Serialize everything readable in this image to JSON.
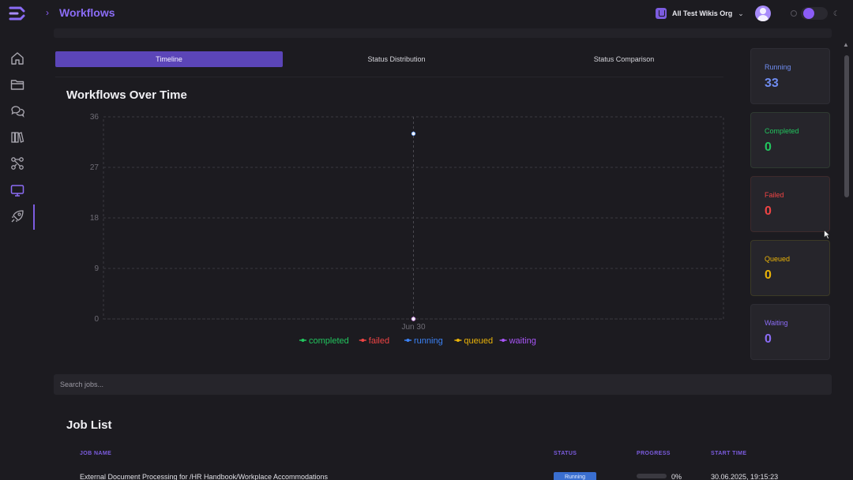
{
  "header": {
    "breadcrumb_title": "Workflows",
    "org_name": "All Test Wikis Org"
  },
  "sidebar": {
    "items": [
      {
        "icon": "home-icon"
      },
      {
        "icon": "folder-icon"
      },
      {
        "icon": "chat-icon"
      },
      {
        "icon": "library-icon"
      },
      {
        "icon": "workflow-icon"
      },
      {
        "icon": "monitor-icon",
        "active": true
      },
      {
        "icon": "rocket-icon"
      }
    ]
  },
  "tabs": [
    {
      "label": "Timeline",
      "active": true
    },
    {
      "label": "Status Distribution",
      "active": false
    },
    {
      "label": "Status Comparison",
      "active": false
    }
  ],
  "chart": {
    "title": "Workflows Over Time"
  },
  "chart_data": {
    "type": "line",
    "title": "Workflows Over Time",
    "x": [
      "Jun 30"
    ],
    "y_ticks": [
      0,
      9,
      18,
      27,
      36
    ],
    "ylim": [
      0,
      36
    ],
    "grid": true,
    "legend_position": "bottom",
    "series": [
      {
        "name": "completed",
        "values": [
          0
        ],
        "color": "#22c55e"
      },
      {
        "name": "failed",
        "values": [
          0
        ],
        "color": "#ef4444"
      },
      {
        "name": "running",
        "values": [
          33
        ],
        "color": "#3b82f6"
      },
      {
        "name": "queued",
        "values": [
          0
        ],
        "color": "#eab308"
      },
      {
        "name": "waiting",
        "values": [
          0
        ],
        "color": "#a855f7"
      }
    ]
  },
  "status_cards": [
    {
      "label": "Running",
      "value": "33",
      "color": "#6f8cf0",
      "border": "#2e2d34"
    },
    {
      "label": "Completed",
      "value": "0",
      "color": "#22c55e",
      "border": "#2f3a31"
    },
    {
      "label": "Failed",
      "value": "0",
      "color": "#ef4444",
      "border": "#3d2a2c"
    },
    {
      "label": "Queued",
      "value": "0",
      "color": "#eab308",
      "border": "#3c3a26"
    },
    {
      "label": "Waiting",
      "value": "0",
      "color": "#8b6cf6",
      "border": "#2e2d34"
    }
  ],
  "search": {
    "placeholder": "Search jobs..."
  },
  "job_list": {
    "title": "Job List",
    "columns": [
      "JOB NAME",
      "STATUS",
      "PROGRESS",
      "START TIME"
    ],
    "rows": [
      {
        "name": "External Document Processing for /HR Handbook/Workplace Accommodations",
        "status": "Running",
        "progress": "0%",
        "progress_fraction": 0,
        "start_time": "30.06.2025, 19:15:23"
      }
    ]
  }
}
